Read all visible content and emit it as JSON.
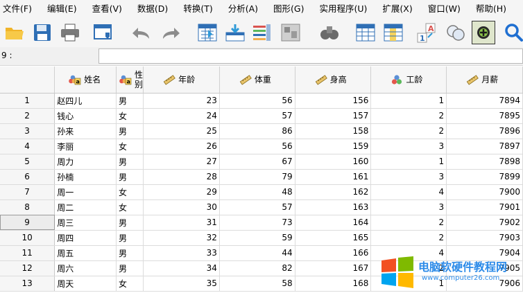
{
  "menu": [
    "文件(F)",
    "编辑(E)",
    "查看(V)",
    "数据(D)",
    "转换(T)",
    "分析(A)",
    "图形(G)",
    "实用程序(U)",
    "扩展(X)",
    "窗口(W)",
    "帮助(H)"
  ],
  "toolbar": {
    "icons": [
      "open-folder-icon",
      "save-icon",
      "print-icon",
      "recall-dialog-icon",
      "undo-icon",
      "redo-icon",
      "go-to-case-icon",
      "go-to-variable-icon",
      "variables-icon",
      "run-descriptives-icon",
      "find-icon",
      "insert-cases-icon",
      "insert-variable-icon",
      "split-file-icon",
      "weight-cases-icon",
      "select-cases-icon",
      "value-labels-icon",
      "use-sets-icon",
      "search-icon"
    ]
  },
  "editor": {
    "cell_ref": "9 :",
    "value": ""
  },
  "columns": [
    {
      "name": "姓名",
      "type": "nominal-string"
    },
    {
      "name": "性\n别",
      "type": "nominal-string"
    },
    {
      "name": "年龄",
      "type": "scale"
    },
    {
      "name": "体重",
      "type": "scale"
    },
    {
      "name": "身高",
      "type": "scale"
    },
    {
      "name": "工龄",
      "type": "nominal"
    },
    {
      "name": "月薪",
      "type": "scale"
    }
  ],
  "rows": [
    {
      "n": "1",
      "cells": [
        "赵四儿",
        "男",
        "23",
        "56",
        "156",
        "1",
        "7894"
      ]
    },
    {
      "n": "2",
      "cells": [
        "钱心",
        "女",
        "24",
        "57",
        "157",
        "2",
        "7895"
      ]
    },
    {
      "n": "3",
      "cells": [
        "孙来",
        "男",
        "25",
        "86",
        "158",
        "2",
        "7896"
      ]
    },
    {
      "n": "4",
      "cells": [
        "李丽",
        "女",
        "26",
        "56",
        "159",
        "3",
        "7897"
      ]
    },
    {
      "n": "5",
      "cells": [
        "周力",
        "男",
        "27",
        "67",
        "160",
        "1",
        "7898"
      ]
    },
    {
      "n": "6",
      "cells": [
        "孙楠",
        "男",
        "28",
        "79",
        "161",
        "3",
        "7899"
      ]
    },
    {
      "n": "7",
      "cells": [
        "周一",
        "女",
        "29",
        "48",
        "162",
        "4",
        "7900"
      ]
    },
    {
      "n": "8",
      "cells": [
        "周二",
        "女",
        "30",
        "57",
        "163",
        "3",
        "7901"
      ]
    },
    {
      "n": "9",
      "cells": [
        "周三",
        "男",
        "31",
        "73",
        "164",
        "2",
        "7902"
      ]
    },
    {
      "n": "10",
      "cells": [
        "周四",
        "男",
        "32",
        "59",
        "165",
        "2",
        "7903"
      ]
    },
    {
      "n": "11",
      "cells": [
        "周五",
        "男",
        "33",
        "44",
        "166",
        "4",
        "7904"
      ]
    },
    {
      "n": "12",
      "cells": [
        "周六",
        "男",
        "34",
        "82",
        "167",
        "2",
        "7905"
      ]
    },
    {
      "n": "13",
      "cells": [
        "周天",
        "女",
        "35",
        "58",
        "168",
        "1",
        "7906"
      ]
    }
  ],
  "selected_row": "9",
  "watermark": {
    "title": "电脑软硬件教程网",
    "url": "www.computer26.com"
  },
  "colors": {
    "menubar": "#f5f5f5",
    "header": "#f6f6f6",
    "watermark": "#2d8be8"
  }
}
